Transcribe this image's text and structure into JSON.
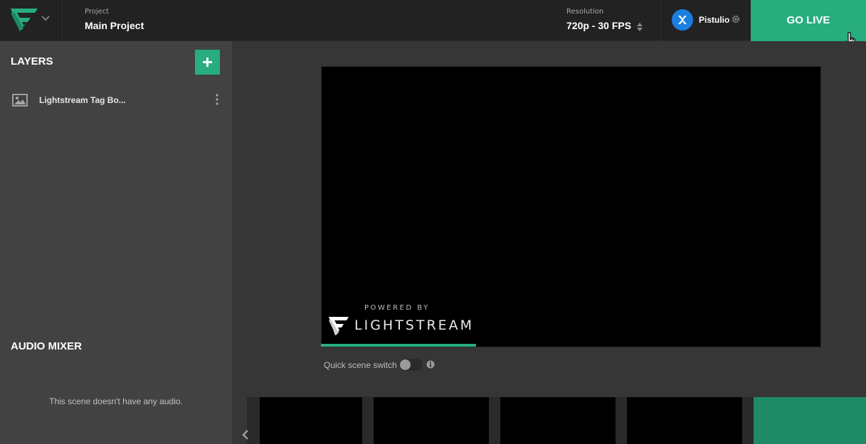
{
  "header": {
    "project_label": "Project",
    "project_name": "Main Project",
    "resolution_label": "Resolution",
    "resolution_value": "720p - 30 FPS",
    "username": "Pistulio",
    "go_live_label": "GO LIVE"
  },
  "sidebar": {
    "layers_title": "LAYERS",
    "layers": [
      {
        "name": "Lightstream Tag Bo...",
        "icon": "image-icon"
      }
    ],
    "audio_title": "AUDIO MIXER",
    "audio_empty": "This scene doesn't have any audio."
  },
  "preview": {
    "powered_by": "POWERED BY",
    "brand": "LIGHTSTREAM",
    "progress": 0.31
  },
  "controls": {
    "quick_scene_switch_label": "Quick scene switch",
    "quick_scene_switch_on": false
  },
  "scenes": {
    "count": 4
  },
  "colors": {
    "accent": "#27ad7e",
    "avatar": "#1a7fe0",
    "topbar": "#222222",
    "sidebar": "#424242"
  }
}
